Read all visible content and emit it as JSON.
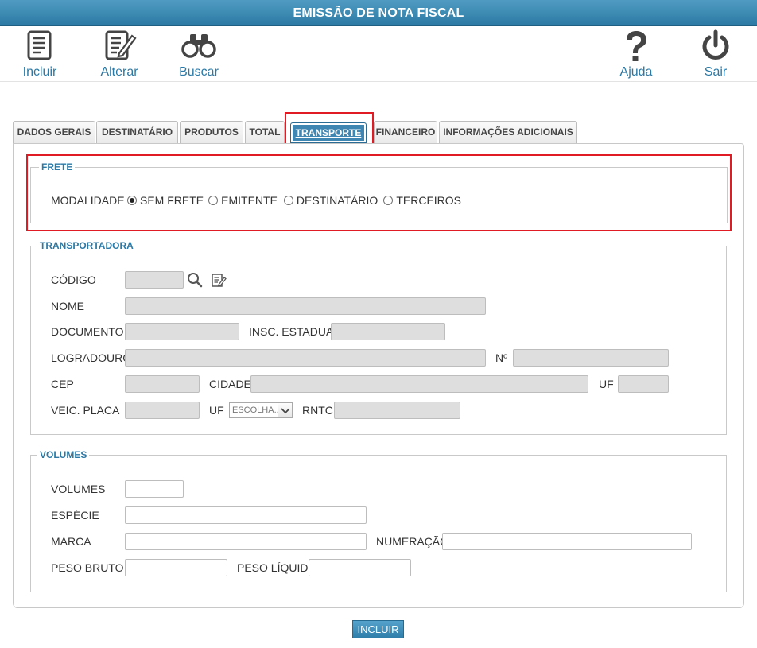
{
  "window": {
    "title": "EMISSÃO DE NOTA FISCAL"
  },
  "toolbar": {
    "incluir": "Incluir",
    "alterar": "Alterar",
    "buscar": "Buscar",
    "ajuda": "Ajuda",
    "sair": "Sair"
  },
  "tabs": [
    {
      "label": "DADOS GERAIS"
    },
    {
      "label": "DESTINATÁRIO"
    },
    {
      "label": "PRODUTOS"
    },
    {
      "label": "TOTAL"
    },
    {
      "label": "TRANSPORTE",
      "active": true
    },
    {
      "label": "FINANCEIRO"
    },
    {
      "label": "INFORMAÇÕES ADICIONAIS"
    }
  ],
  "frete": {
    "legend": "FRETE",
    "modalidade_label": "MODALIDADE",
    "options": [
      "SEM FRETE",
      "EMITENTE",
      "DESTINATÁRIO",
      "TERCEIROS"
    ],
    "selected": "SEM FRETE"
  },
  "transportadora": {
    "legend": "TRANSPORTADORA",
    "codigo": "CÓDIGO",
    "nome": "NOME",
    "documento": "DOCUMENTO",
    "insc_estadual": "INSC. ESTADUAL",
    "logradouro": "LOGRADOURO",
    "numero": "Nº",
    "cep": "CEP",
    "cidade": "CIDADE",
    "uf": "UF",
    "veic_placa": "VEIC. PLACA",
    "uf2": "UF",
    "uf_select_value": "ESCOLHA...",
    "rntc": "RNTC"
  },
  "volumes": {
    "legend": "VOLUMES",
    "volumes": "VOLUMES",
    "especie": "ESPÉCIE",
    "marca": "MARCA",
    "numeracao": "NUMERAÇÃO",
    "peso_bruto": "PESO BRUTO",
    "peso_liquido": "PESO LÍQUIDO"
  },
  "actions": {
    "incluir": "INCLUIR"
  },
  "colors": {
    "accent": "#2b79a6",
    "highlight": "#e01b24"
  }
}
